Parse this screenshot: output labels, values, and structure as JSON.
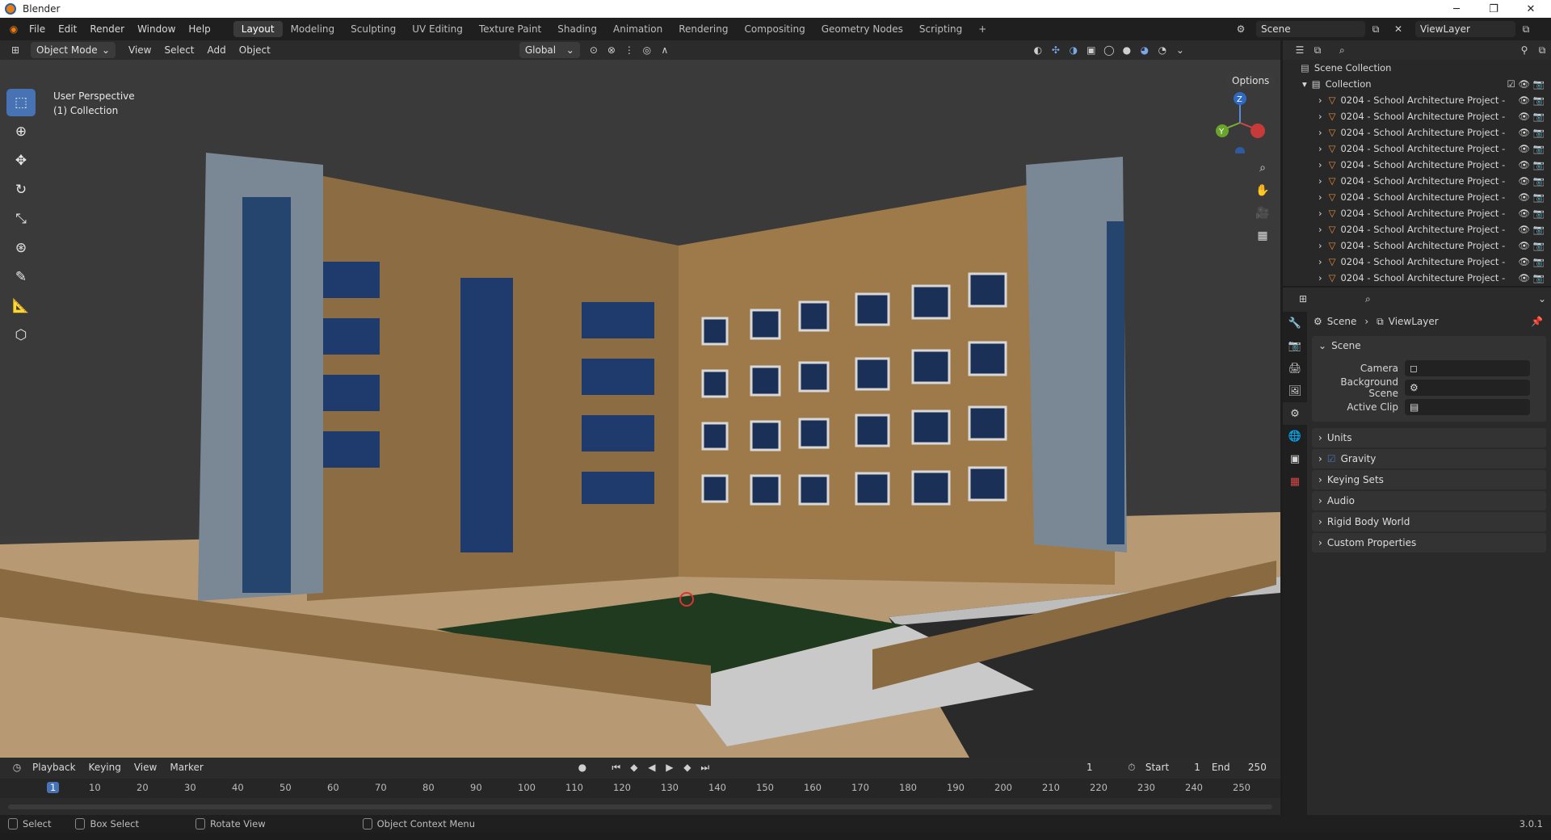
{
  "window": {
    "title": "Blender",
    "min": "─",
    "max": "❐",
    "close": "✕"
  },
  "menu": [
    "File",
    "Edit",
    "Render",
    "Window",
    "Help"
  ],
  "workspaces": [
    "Layout",
    "Modeling",
    "Sculpting",
    "UV Editing",
    "Texture Paint",
    "Shading",
    "Animation",
    "Rendering",
    "Compositing",
    "Geometry Nodes",
    "Scripting",
    "+"
  ],
  "scene_field": "Scene",
  "viewlayer_field": "ViewLayer",
  "header": {
    "mode": "Object Mode",
    "menus": [
      "View",
      "Select",
      "Add",
      "Object"
    ],
    "orientation": "Global",
    "options": "Options"
  },
  "viewport": {
    "perspective": "User Perspective",
    "collection": "(1) Collection",
    "gizmo": {
      "z": "Z",
      "y": "Y"
    }
  },
  "outliner": {
    "scene_collection": "Scene Collection",
    "collection": "Collection",
    "items": [
      "0204 - School Architecture Project -",
      "0204 - School Architecture Project -",
      "0204 - School Architecture Project -",
      "0204 - School Architecture Project -",
      "0204 - School Architecture Project -",
      "0204 - School Architecture Project -",
      "0204 - School Architecture Project -",
      "0204 - School Architecture Project -",
      "0204 - School Architecture Project -",
      "0204 - School Architecture Project -",
      "0204 - School Architecture Project -",
      "0204 - School Architecture Project -"
    ]
  },
  "properties": {
    "breadcrumb": {
      "scene": "Scene",
      "viewlayer": "ViewLayer"
    },
    "section": "Scene",
    "fields": {
      "camera": "Camera",
      "background": "Background Scene",
      "clip": "Active Clip"
    },
    "panels": [
      "Units",
      "Gravity",
      "Keying Sets",
      "Audio",
      "Rigid Body World",
      "Custom Properties"
    ]
  },
  "timeline": {
    "menus": [
      "Playback",
      "Keying",
      "View",
      "Marker"
    ],
    "current_frame": "1",
    "start_label": "Start",
    "start": "1",
    "end_label": "End",
    "end": "250",
    "ticks": [
      "1",
      "10",
      "20",
      "30",
      "40",
      "50",
      "60",
      "70",
      "80",
      "90",
      "100",
      "110",
      "120",
      "130",
      "140",
      "150",
      "160",
      "170",
      "180",
      "190",
      "200",
      "210",
      "220",
      "230",
      "240",
      "250"
    ]
  },
  "status": {
    "select": "Select",
    "box_select": "Box Select",
    "rotate": "Rotate View",
    "context": "Object Context Menu",
    "version": "3.0.1"
  }
}
